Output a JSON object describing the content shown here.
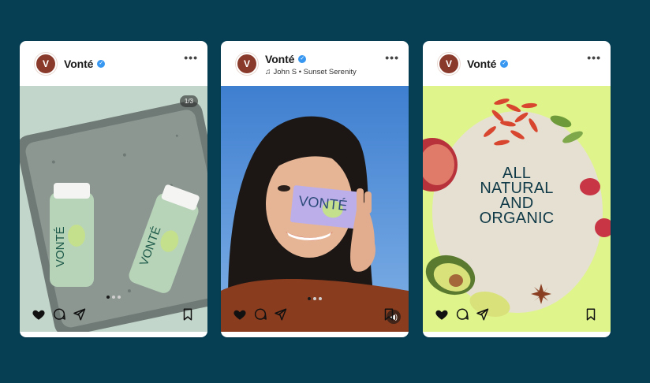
{
  "posts": [
    {
      "brand": "Vonté",
      "avatar_letter": "V",
      "counter": "1/3",
      "product_label": "VONTÉ"
    },
    {
      "brand": "Vonté",
      "avatar_letter": "V",
      "music": "John S • Sunset Serenity",
      "product_label": "VONTÉ"
    },
    {
      "brand": "Vonté",
      "avatar_letter": "V",
      "overlay_lines": [
        "ALL",
        "NATURAL",
        "AND",
        "ORGANIC"
      ]
    }
  ],
  "icons": {
    "verified": "verified-badge-icon",
    "more": "more-options-icon",
    "like": "heart-icon",
    "comment": "comment-icon",
    "share": "send-icon",
    "save": "bookmark-icon",
    "music": "music-note-icon",
    "sound": "speaker-icon"
  },
  "colors": {
    "background": "#063f54",
    "avatar": "#8a3a2a",
    "verified": "#3897f0"
  }
}
